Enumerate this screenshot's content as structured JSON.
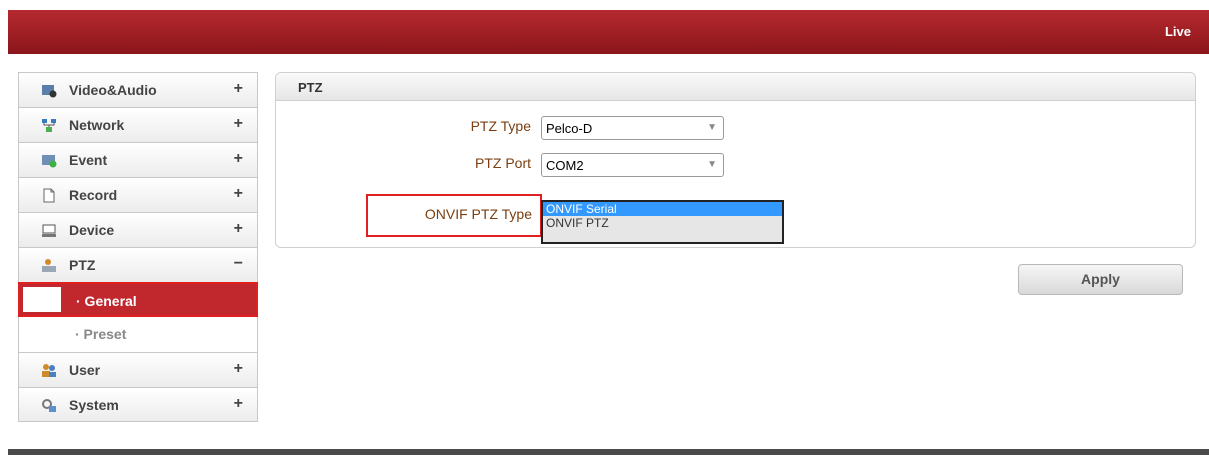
{
  "header": {
    "live_label": "Live"
  },
  "sidebar": {
    "items": [
      {
        "label": "Video&Audio",
        "toggle": "+",
        "icon": "video-audio-icon"
      },
      {
        "label": "Network",
        "toggle": "+",
        "icon": "network-icon"
      },
      {
        "label": "Event",
        "toggle": "+",
        "icon": "event-icon"
      },
      {
        "label": "Record",
        "toggle": "+",
        "icon": "record-icon"
      },
      {
        "label": "Device",
        "toggle": "+",
        "icon": "device-icon"
      },
      {
        "label": "PTZ",
        "toggle": "−",
        "icon": "ptz-icon",
        "subitems": [
          {
            "label": "· General",
            "active": true
          },
          {
            "label": "· Preset",
            "active": false
          }
        ]
      },
      {
        "label": "User",
        "toggle": "+",
        "icon": "user-icon"
      },
      {
        "label": "System",
        "toggle": "+",
        "icon": "system-icon"
      }
    ]
  },
  "panel": {
    "title": "PTZ",
    "fields": {
      "ptz_type": {
        "label": "PTZ Type",
        "value": "Pelco-D"
      },
      "ptz_port": {
        "label": "PTZ Port",
        "value": "COM2"
      },
      "onvif_ptz_type": {
        "label": "ONVIF PTZ Type",
        "options": [
          "ONVIF Serial",
          "ONVIF PTZ"
        ],
        "selected": "ONVIF Serial"
      }
    }
  },
  "actions": {
    "apply_label": "Apply"
  },
  "colors": {
    "brand_red": "#9b1d22",
    "selection_blue": "#3399ff",
    "highlight_red": "#e02020"
  }
}
